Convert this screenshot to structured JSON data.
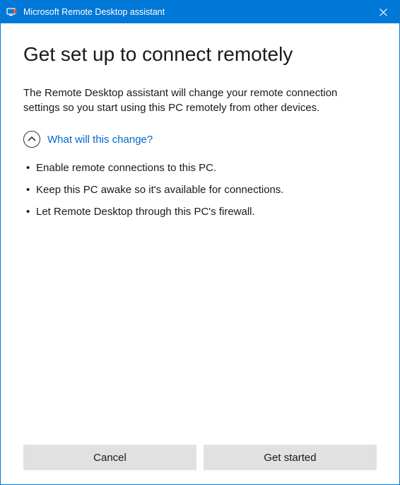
{
  "titlebar": {
    "title": "Microsoft Remote Desktop assistant"
  },
  "main": {
    "heading": "Get set up to connect remotely",
    "intro": "The Remote Desktop assistant will change your remote connection settings so you start using this PC remotely from other devices.",
    "expander_label": "What will this change?",
    "bullets": [
      "Enable remote connections to this PC.",
      "Keep this PC awake so it's available for connections.",
      "Let Remote Desktop through this PC's firewall."
    ]
  },
  "buttons": {
    "cancel": "Cancel",
    "get_started": "Get started"
  },
  "colors": {
    "accent": "#0078d7",
    "link": "#0066cc"
  }
}
